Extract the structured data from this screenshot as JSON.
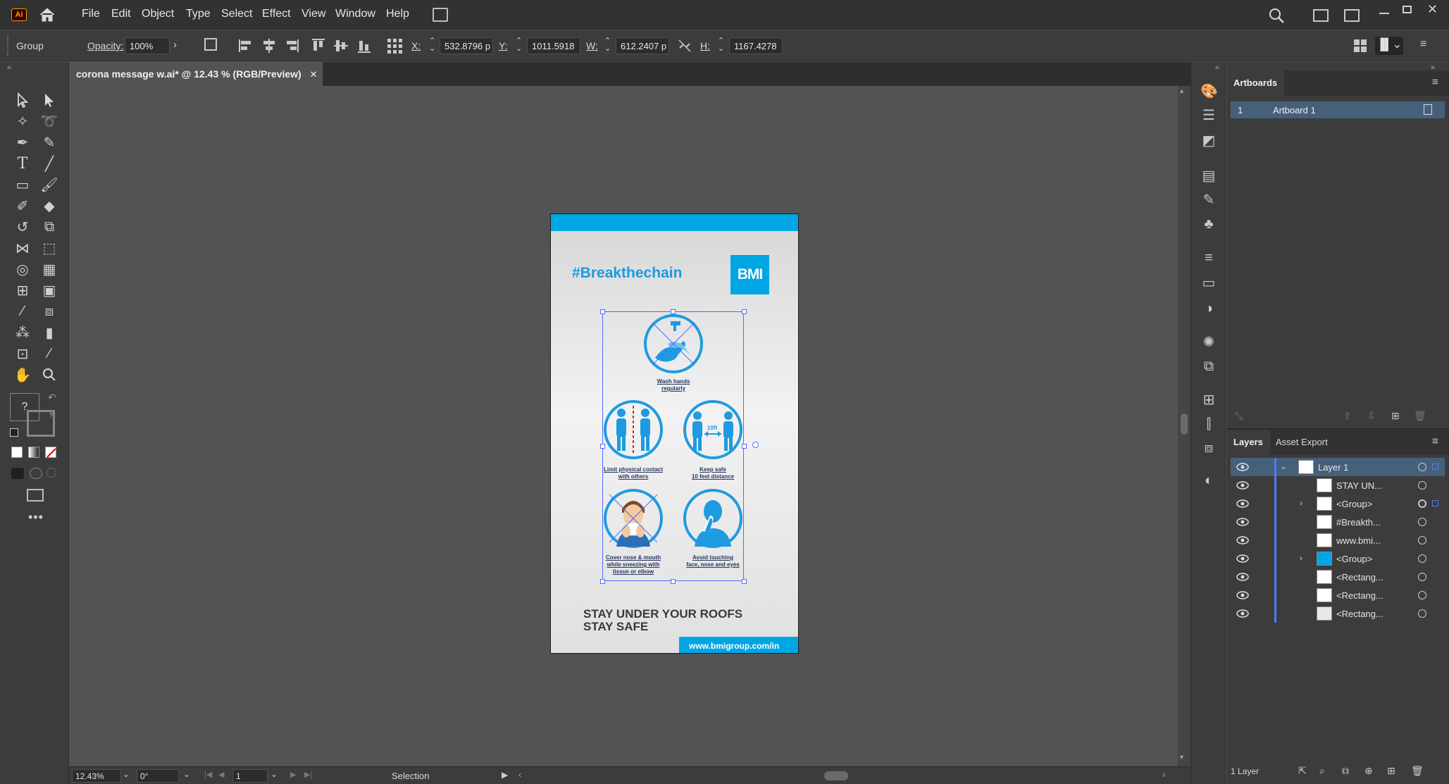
{
  "app": {
    "logo": "Ai"
  },
  "menu": [
    "File",
    "Edit",
    "Object",
    "Type",
    "Select",
    "Effect",
    "View",
    "Window",
    "Help"
  ],
  "control_bar": {
    "selection_type": "Group",
    "opacity_label": "Opacity:",
    "opacity_value": "100%",
    "x_label": "X:",
    "x_value": "532.8796 p",
    "y_label": "Y:",
    "y_value": "1011.5918",
    "w_label": "W:",
    "w_value": "612.2407 p",
    "h_label": "H:",
    "h_value": "1167.4278"
  },
  "document_tab": {
    "title": "corona message w.ai* @ 12.43 % (RGB/Preview)"
  },
  "status_bar": {
    "zoom": "12.43%",
    "rotation": "0°",
    "artboard_number": "1",
    "tool": "Selection"
  },
  "artboards_panel": {
    "title": "Artboards",
    "items": [
      {
        "number": "1",
        "name": "Artboard 1"
      }
    ]
  },
  "layers_panel": {
    "tabs": [
      "Layers",
      "Asset Export"
    ],
    "rows": [
      {
        "name": "Layer 1",
        "level": 0,
        "expanded": true
      },
      {
        "name": "STAY UN...",
        "level": 1
      },
      {
        "name": "<Group>",
        "level": 1,
        "expandable": true
      },
      {
        "name": "#Breakth...",
        "level": 1
      },
      {
        "name": "www.bmi...",
        "level": 1
      },
      {
        "name": "<Group>",
        "level": 1,
        "expandable": true
      },
      {
        "name": "<Rectang...",
        "level": 1
      },
      {
        "name": "<Rectang...",
        "level": 1
      },
      {
        "name": "<Rectang...",
        "level": 1
      }
    ],
    "footer": "1 Layer"
  },
  "poster": {
    "hashtag": "#Breakthechain",
    "logo": "BMI",
    "captions": [
      "Wash hands\nregularly",
      "Limit physical contact\nwith others",
      "Keep safe\n10 feet distance",
      "Cover nose & mouth\nwhile sneezing with\ntissue or elbow",
      "Avoid touching\nface, nose and eyes"
    ],
    "distance_label": "10ft",
    "headline_1": "STAY UNDER YOUR ROOFS",
    "headline_2": "STAY SAFE",
    "url": "www.bmigroup.com/in",
    "colors": {
      "brand_blue": "#00a5e3",
      "icon_blue": "#1e9be0",
      "text_dark": "#3a3a3a"
    }
  }
}
